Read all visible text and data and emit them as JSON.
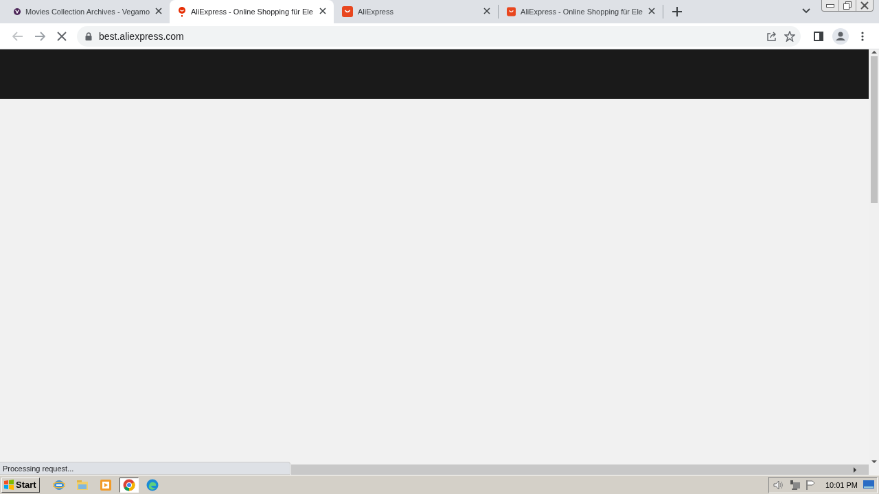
{
  "tabs": [
    {
      "title": "Movies Collection Archives - Vegamo",
      "kind": "vlogo",
      "selected": false
    },
    {
      "title": "AliExpress - Online Shopping für Ele",
      "kind": "pin",
      "selected": true
    },
    {
      "title": "AliExpress",
      "kind": "bag",
      "selected": false
    },
    {
      "title": "AliExpress - Online Shopping für Ele",
      "kind": "bag",
      "selected": false
    }
  ],
  "toolbar": {
    "address": "best.aliexpress.com",
    "loading": true
  },
  "status_text": "Processing request...",
  "taskbar": {
    "start": "Start",
    "apps": [
      {
        "kind": "ie",
        "active": false
      },
      {
        "kind": "explorer",
        "active": false
      },
      {
        "kind": "media",
        "active": false
      },
      {
        "kind": "chrome",
        "active": true
      },
      {
        "kind": "edge",
        "active": false
      }
    ],
    "clock": "10:01 PM"
  }
}
